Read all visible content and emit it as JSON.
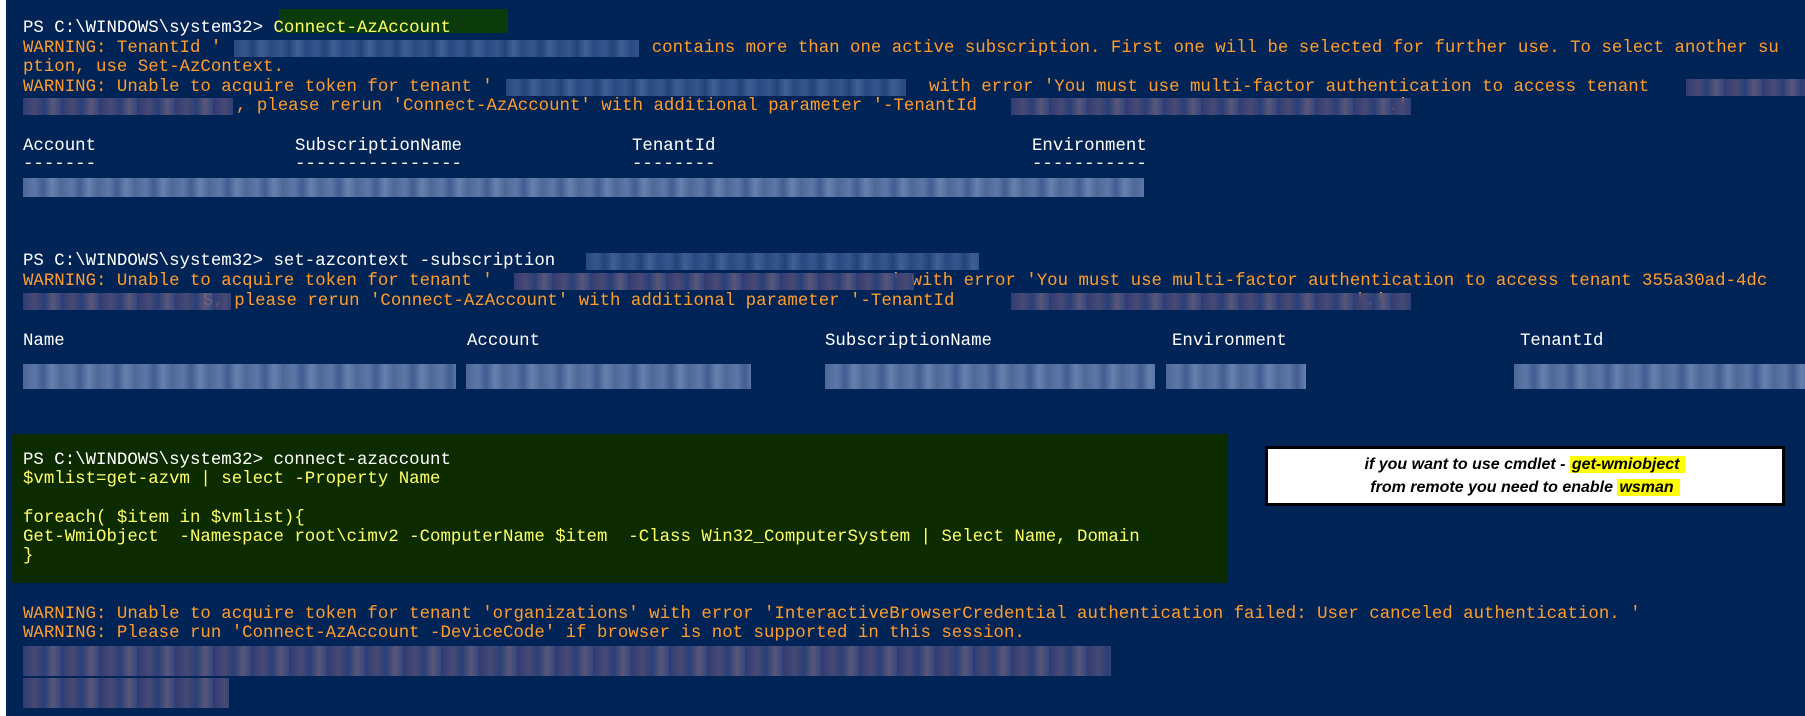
{
  "console": {
    "session1": {
      "prompt": "PS C:\\WINDOWS\\system32> ",
      "command": "Connect-AzAccount",
      "warning1_part1": "WARNING: TenantId '",
      "warning1_part2": " contains more than one active subscription. First one will be selected for further use. To select another su",
      "warning1_line2": "ption, use Set-AzContext.",
      "warning2_part1": "WARNING: Unable to acquire token for tenant '",
      "warning2_part2": " with error 'You must use multi-factor authentication to access tenant",
      "warning2_line2_part1": ", please rerun 'Connect-AzAccount' with additional parameter '-TenantId ",
      "warning2_line2_part2": ".'",
      "table": {
        "headers": [
          "Account",
          "SubscriptionName",
          "TenantId",
          "Environment"
        ],
        "underlines": [
          "-------",
          "----------------",
          "--------",
          "-----------"
        ]
      }
    },
    "session2": {
      "prompt": "PS C:\\WINDOWS\\system32> ",
      "command": "set-azcontext -subscription",
      "warning1_part1": "WARNING: Unable to acquire token for tenant '",
      "warning1_part2": "' with error 'You must use multi-factor authentication to access tenant 355a30ad-4dc",
      "warning1_line2_part1": "S, please rerun 'Connect-AzAccount' with additional parameter '-TenantId ",
      "warning1_line2_part2": "'.'",
      "table": {
        "headers": [
          "Name",
          "Account",
          "SubscriptionName",
          "Environment",
          "TenantId"
        ]
      }
    },
    "session3": {
      "code_lines": [
        "PS C:\\WINDOWS\\system32> connect-azaccount",
        "$vmlist=get-azvm | select -Property Name",
        "",
        "foreach( $item in $vmlist){",
        "Get-WmiObject  -Namespace root\\cimv2 -ComputerName $item  -Class Win32_ComputerSystem | Select Name, Domain",
        "}"
      ],
      "warnings": [
        "WARNING: Unable to acquire token for tenant 'organizations' with error 'InteractiveBrowserCredential authentication failed: User canceled authentication. '",
        "WARNING: Please run 'Connect-AzAccount -DeviceCode' if browser is not supported in this session."
      ]
    }
  },
  "note": {
    "line1_text": "if you want to use cmdlet - ",
    "line1_highlight": "get-wmiobject",
    "line2_text": "from remote you need to enable ",
    "line2_highlight": "wsman"
  },
  "colors": {
    "background": "#012456",
    "prompt": "#ffffff",
    "command": "#ffff66",
    "warning": "#ff9d2b",
    "code_block": "#0c2c00",
    "note_highlight": "#ffff00"
  }
}
